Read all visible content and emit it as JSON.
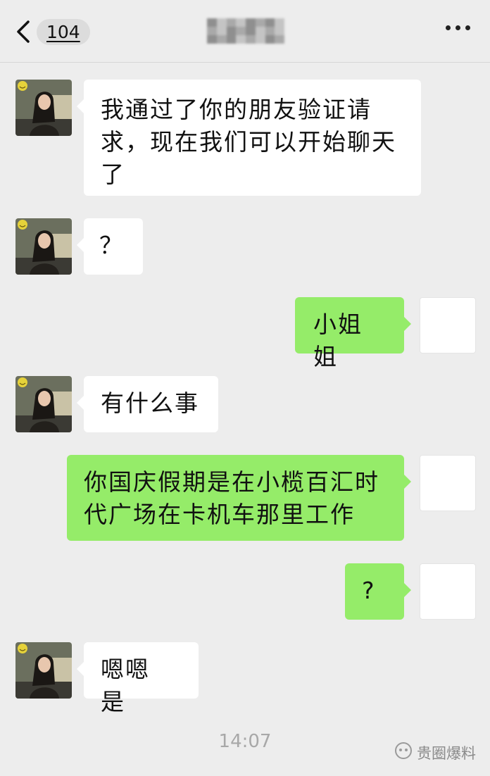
{
  "header": {
    "back_icon": "chevron-left-icon",
    "unread_count": "104",
    "more_icon": "more-dots-icon"
  },
  "messages": [
    {
      "direction": "in",
      "text": "我通过了你的朋友验证请求，现在我们可以开始聊天了"
    },
    {
      "direction": "in",
      "text": "？"
    },
    {
      "direction": "out",
      "text": "小姐姐"
    },
    {
      "direction": "in",
      "text": "有什么事"
    },
    {
      "direction": "out",
      "text": "你国庆假期是在小榄百汇时代广场在卡机车那里工作"
    },
    {
      "direction": "out",
      "text": "?"
    },
    {
      "direction": "in",
      "text": "嗯嗯 是"
    }
  ],
  "timestamp": "14:07",
  "watermark": {
    "text": "贵圈爆料",
    "icon": "wechat-channel-icon"
  },
  "colors": {
    "background": "#ededed",
    "incoming_bubble": "#ffffff",
    "outgoing_bubble": "#95ec69"
  }
}
